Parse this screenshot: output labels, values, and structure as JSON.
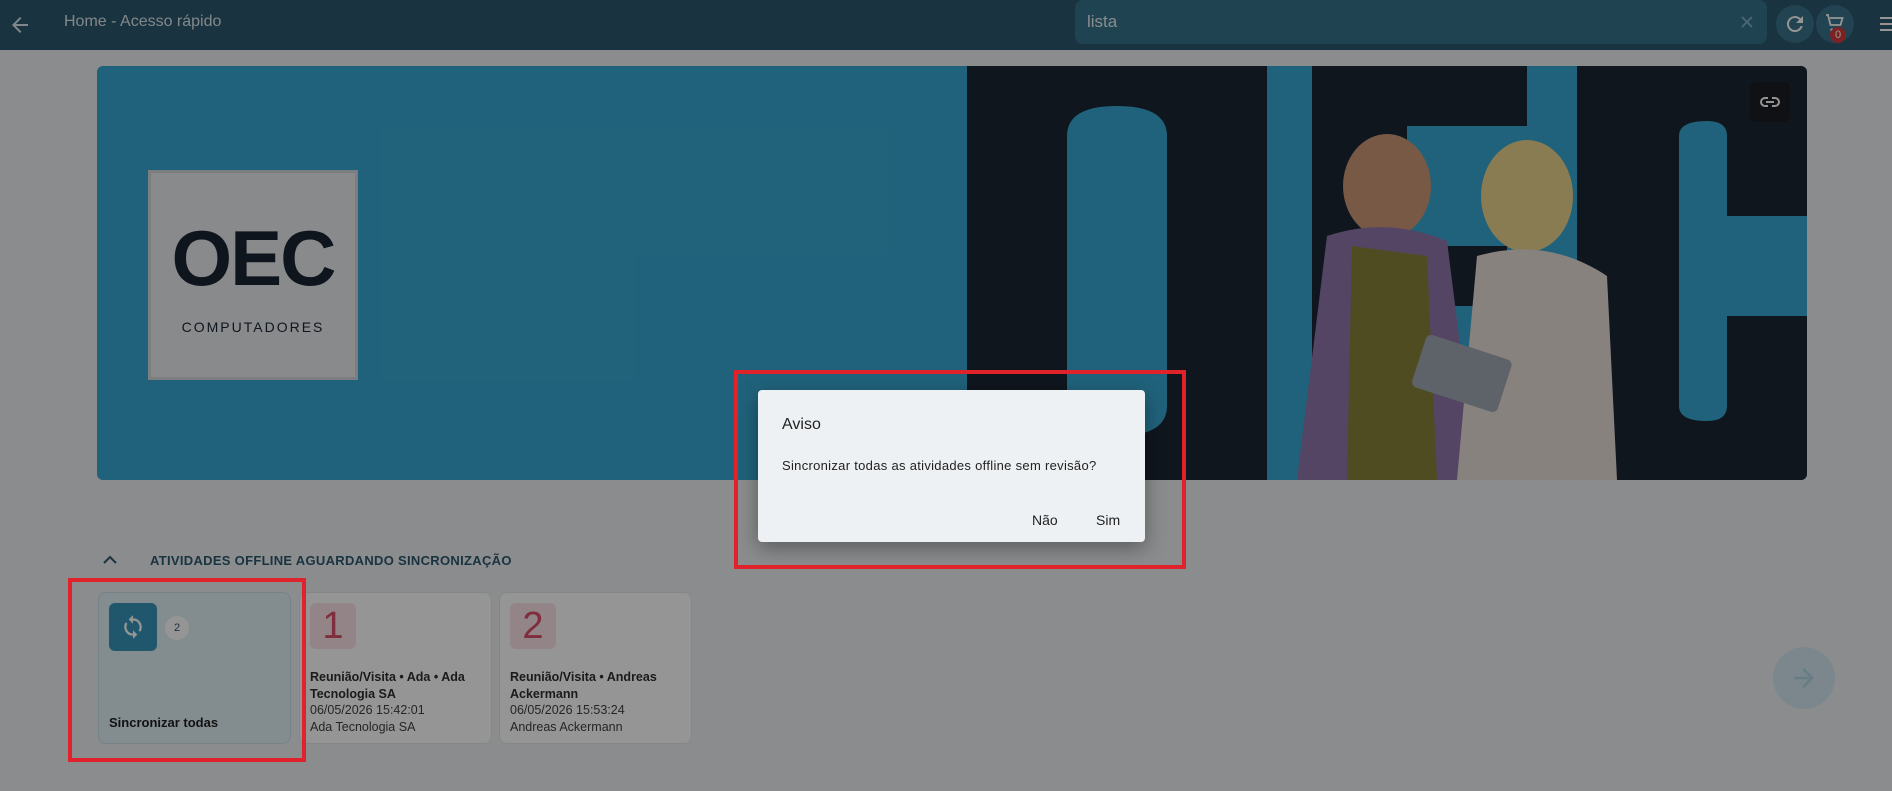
{
  "header": {
    "title": "Home - Acesso rápido",
    "search_value": "lista",
    "cart_count": "0"
  },
  "banner": {
    "logo_main": "OEC",
    "logo_sub": "COMPUTADORES",
    "big_text": "OEC"
  },
  "section": {
    "title": "ATIVIDADES OFFLINE AGUARDANDO SINCRONIZAÇÃO"
  },
  "sync_card": {
    "count": "2",
    "label": "Sincronizar todas"
  },
  "activities": [
    {
      "number": "1",
      "line1": "Reunião/Visita  • Ada • Ada Tecnologia SA",
      "date": "06/05/2026 15:42:01",
      "name": "Ada Tecnologia SA"
    },
    {
      "number": "2",
      "line1": "Reunião/Visita  • Andreas Ackermann",
      "date": "06/05/2026 15:53:24",
      "name": "Andreas Ackermann"
    }
  ],
  "dialog": {
    "title": "Aviso",
    "message": "Sincronizar todas as atividades offline sem revisão?",
    "no_label": "Não",
    "yes_label": "Sim"
  },
  "colors": {
    "topbar": "#1f4e64",
    "banner": "#2aa3cf",
    "accent": "#2a8fb7",
    "highlight": "#e0232b"
  }
}
